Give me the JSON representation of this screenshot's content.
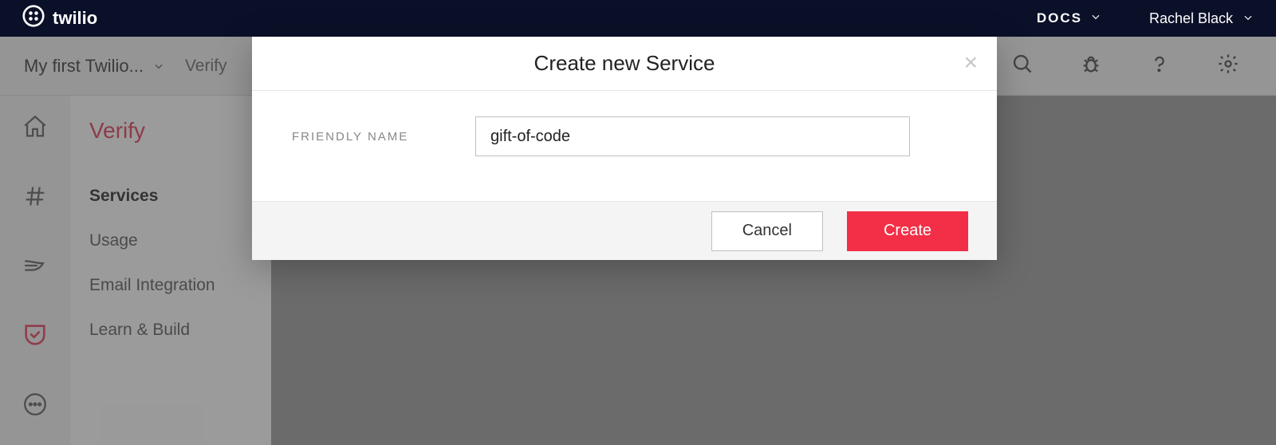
{
  "topbar": {
    "brand": "twilio",
    "docs_label": "DOCS",
    "user_name": "Rachel Black"
  },
  "subbar": {
    "account_name": "My first Twilio...",
    "breadcrumb": "Verify"
  },
  "sidebar": {
    "title": "Verify",
    "items": [
      {
        "label": "Services",
        "active": true
      },
      {
        "label": "Usage",
        "active": false
      },
      {
        "label": "Email Integration",
        "active": false
      },
      {
        "label": "Learn & Build",
        "active": false
      }
    ]
  },
  "modal": {
    "title": "Create new Service",
    "field_label": "FRIENDLY NAME",
    "field_value": "gift-of-code",
    "cancel_label": "Cancel",
    "create_label": "Create"
  }
}
